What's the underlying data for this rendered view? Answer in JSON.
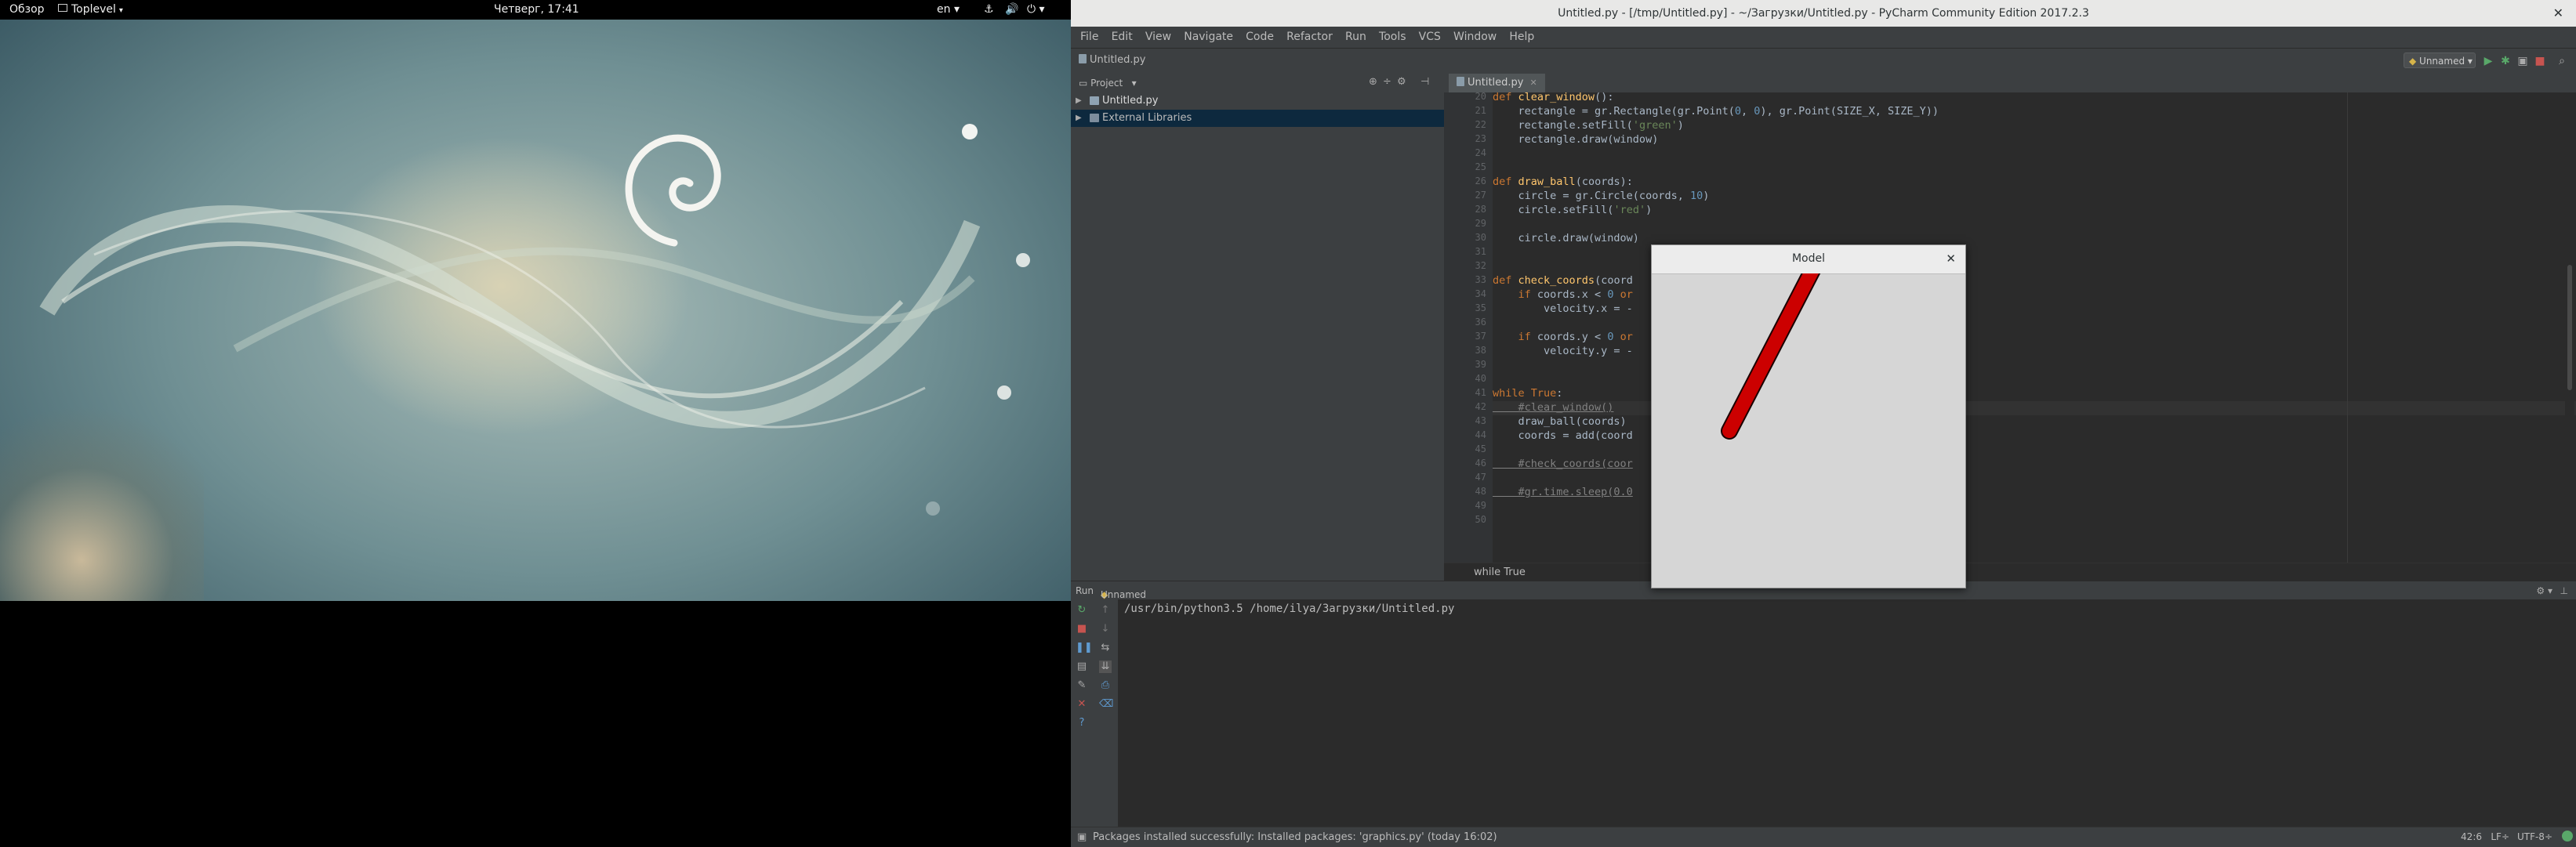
{
  "gnome_topbar": {
    "activities": "Обзор",
    "app_menu": "Toplevel",
    "clock": "Четверг, 17:41",
    "keyboard_layout": "en"
  },
  "pycharm": {
    "window_title": "Untitled.py - [/tmp/Untitled.py] - ~/Загрузки/Untitled.py - PyCharm Community Edition 2017.2.3",
    "menu": [
      "File",
      "Edit",
      "View",
      "Navigate",
      "Code",
      "Refactor",
      "Run",
      "Tools",
      "VCS",
      "Window",
      "Help"
    ],
    "breadcrumb_file": "Untitled.py",
    "run_config": "Unnamed",
    "project_panel_label": "Project",
    "tree": [
      {
        "label": "Untitled.py",
        "icon": "python-file-icon"
      },
      {
        "label": "External Libraries",
        "icon": "library-icon"
      }
    ],
    "editor_tab": "Untitled.py",
    "code_lines": [
      {
        "n": "20",
        "text": "def clear_window():"
      },
      {
        "n": "21",
        "text": "    rectangle = gr.Rectangle(gr.Point(0, 0), gr.Point(SIZE_X, SIZE_Y))"
      },
      {
        "n": "22",
        "text": "    rectangle.setFill('green')"
      },
      {
        "n": "23",
        "text": "    rectangle.draw(window)"
      },
      {
        "n": "24",
        "text": ""
      },
      {
        "n": "25",
        "text": ""
      },
      {
        "n": "26",
        "text": "def draw_ball(coords):"
      },
      {
        "n": "27",
        "text": "    circle = gr.Circle(coords, 10)"
      },
      {
        "n": "28",
        "text": "    circle.setFill('red')"
      },
      {
        "n": "29",
        "text": ""
      },
      {
        "n": "30",
        "text": "    circle.draw(window)"
      },
      {
        "n": "31",
        "text": ""
      },
      {
        "n": "32",
        "text": ""
      },
      {
        "n": "33",
        "text": "def check_coords(coord"
      },
      {
        "n": "34",
        "text": "    if coords.x < 0 or"
      },
      {
        "n": "35",
        "text": "        velocity.x = -"
      },
      {
        "n": "36",
        "text": ""
      },
      {
        "n": "37",
        "text": "    if coords.y < 0 or"
      },
      {
        "n": "38",
        "text": "        velocity.y = -"
      },
      {
        "n": "39",
        "text": ""
      },
      {
        "n": "40",
        "text": ""
      },
      {
        "n": "41",
        "text": "while True:"
      },
      {
        "n": "42",
        "text": "    #clear_window()"
      },
      {
        "n": "43",
        "text": "    draw_ball(coords)"
      },
      {
        "n": "44",
        "text": "    coords = add(coord"
      },
      {
        "n": "45",
        "text": ""
      },
      {
        "n": "46",
        "text": "    #check_coords(coor"
      },
      {
        "n": "47",
        "text": ""
      },
      {
        "n": "48",
        "text": "    #gr.time.sleep(0.0"
      },
      {
        "n": "49",
        "text": ""
      },
      {
        "n": "50",
        "text": ""
      }
    ],
    "code_breadcrumb": "while True",
    "run_panel_label": "Run",
    "run_config_tab": "Unnamed",
    "console_command": "/usr/bin/python3.5 /home/ilya/Загрузки/Untitled.py",
    "status_message": "Packages installed successfully: Installed packages: 'graphics.py' (today 16:02)",
    "caret_position": "42:6",
    "line_separator": "LF",
    "encoding": "UTF-8"
  },
  "model_window": {
    "title": "Model",
    "trail_color": "#cc0000",
    "background": "#d6d6d6"
  },
  "colors": {
    "editor_bg": "#2b2b2b",
    "panel_bg": "#3c3f41",
    "keyword": "#cc7832",
    "function": "#ffc66d",
    "string": "#6a8759",
    "number": "#6897bb",
    "comment": "#808080"
  }
}
